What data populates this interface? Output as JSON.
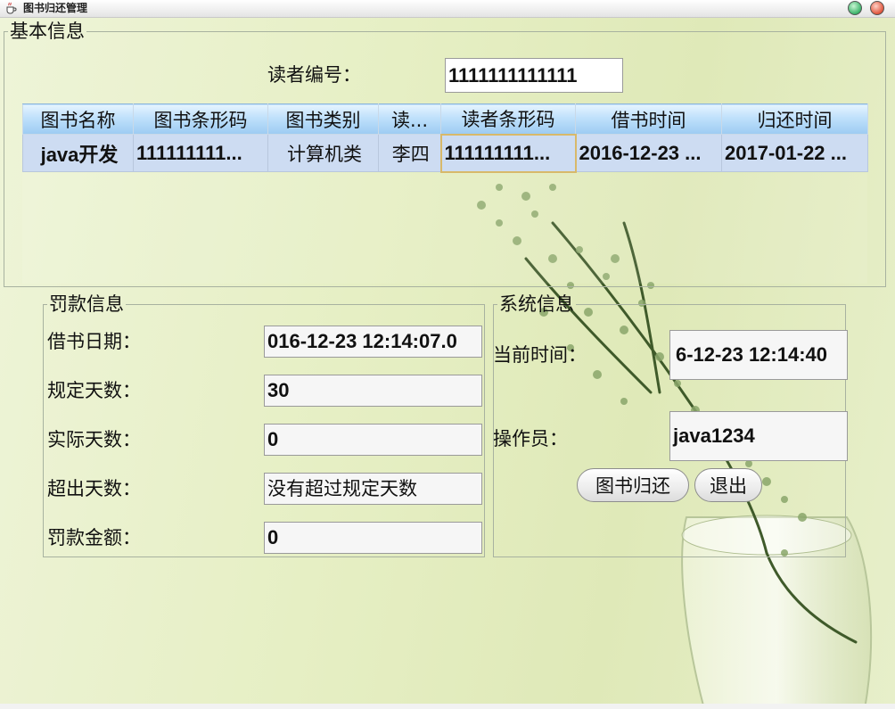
{
  "window": {
    "title": "图书归还管理",
    "icons": {
      "app": "java-cup-icon",
      "minimize": "minimize-icon",
      "close": "close-icon"
    },
    "colors": {
      "minimize": "#3bb36a",
      "close": "#e0553c"
    }
  },
  "basic": {
    "legend": "基本信息",
    "reader_id_label": "读者编号：",
    "reader_id_value": "1111111111111",
    "table": {
      "columns": [
        "图书名称",
        "图书条形码",
        "图书类别",
        "读...",
        "读者条形码",
        "借书时间",
        "归还时间"
      ],
      "rows": [
        [
          "java开发",
          "111111111...",
          "计算机类",
          "李四",
          "111111111...",
          "2016-12-23 ...",
          "2017-01-22 ..."
        ]
      ]
    }
  },
  "fine": {
    "legend": "罚款信息",
    "borrow_date_label": "借书日期：",
    "borrow_date_value": "016-12-23 12:14:07.0",
    "allowed_days_label": "规定天数：",
    "allowed_days_value": "30",
    "actual_days_label": "实际天数：",
    "actual_days_value": "0",
    "over_days_label": "超出天数：",
    "over_days_value": "没有超过规定天数",
    "fine_amount_label": "罚款金额：",
    "fine_amount_value": "0"
  },
  "system": {
    "legend": "系统信息",
    "current_time_label": "当前时间：",
    "current_time_value": "6-12-23 12:14:40",
    "operator_label": "操作员：",
    "operator_value": "java1234",
    "return_button": "图书归还",
    "exit_button": "退出"
  }
}
